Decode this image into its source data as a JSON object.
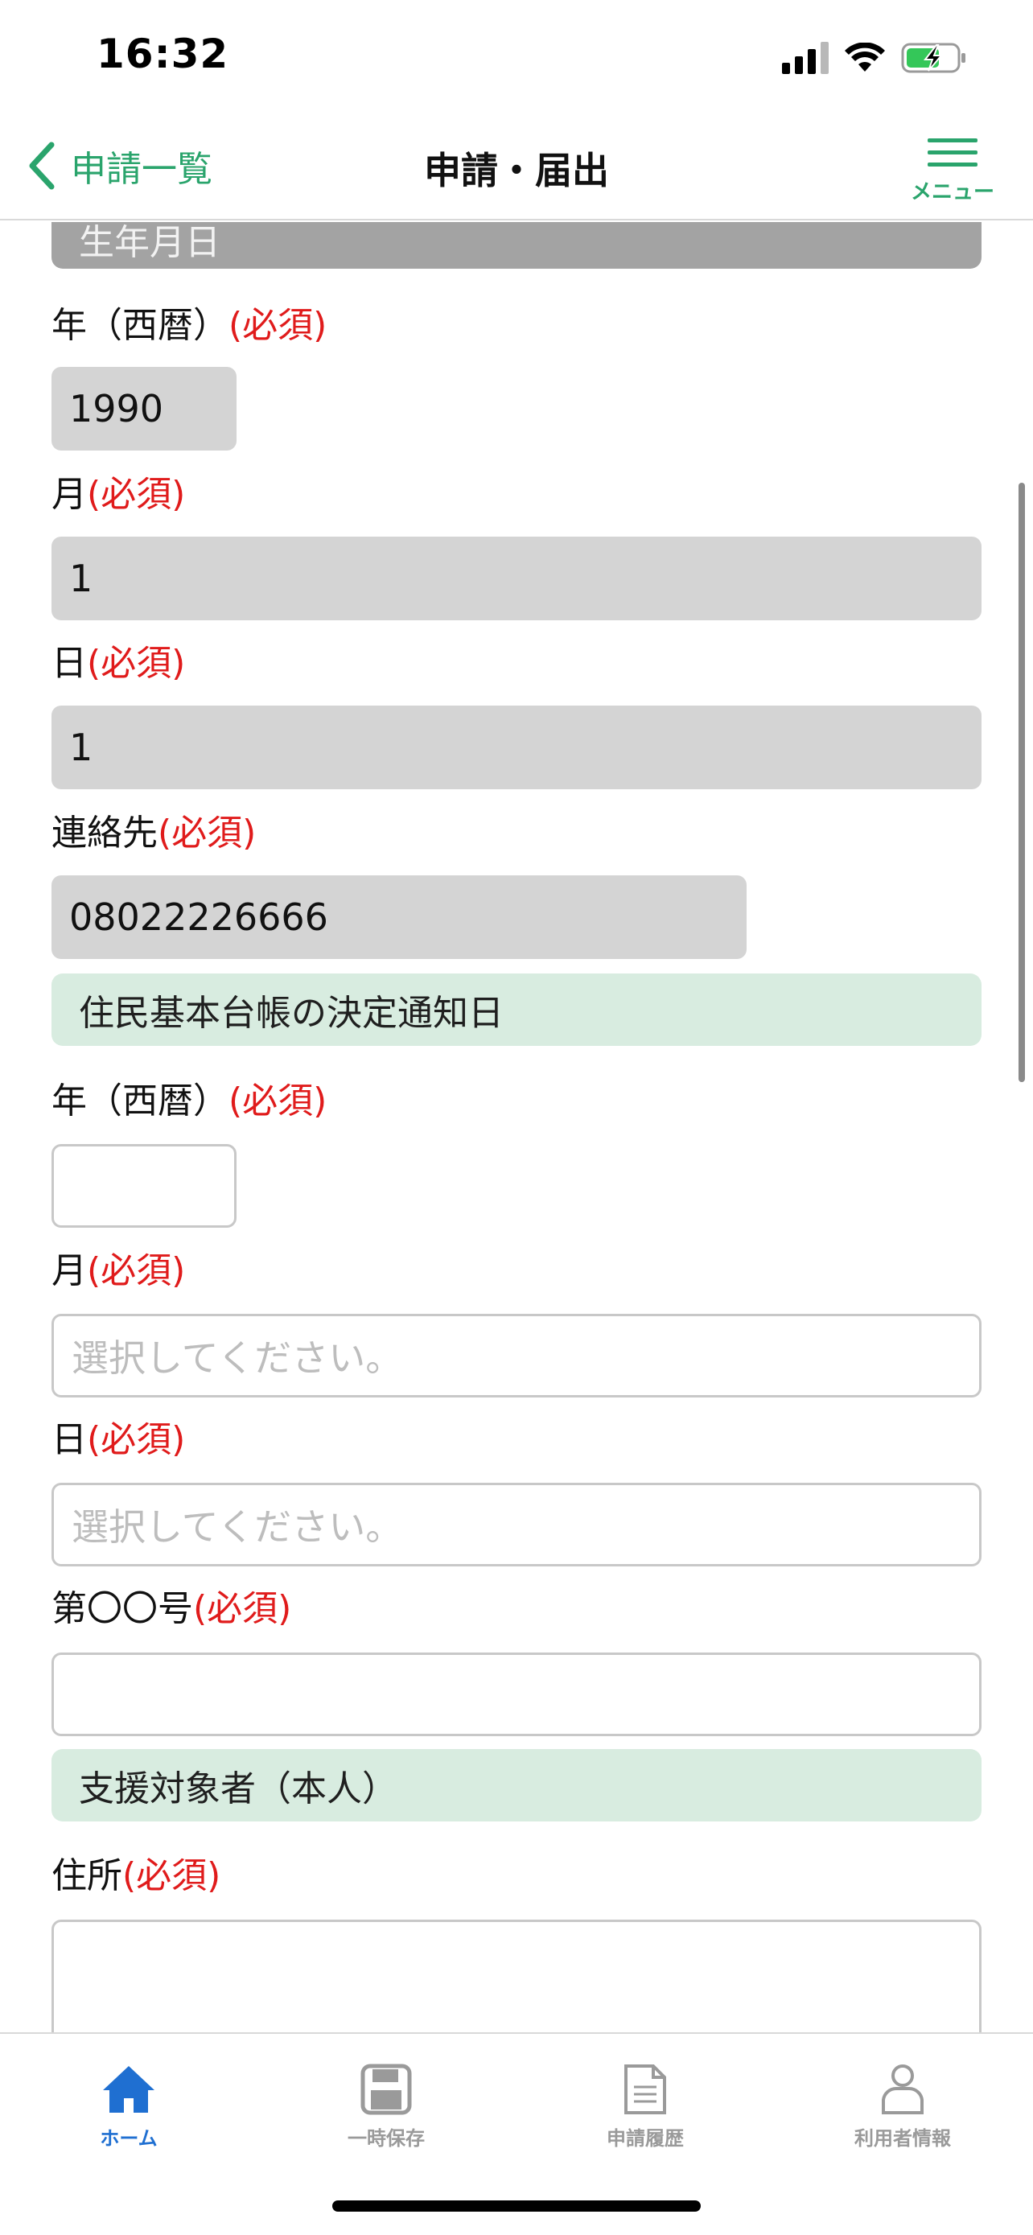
{
  "status_bar": {
    "time": "16:32"
  },
  "nav": {
    "back_label": "申請一覧",
    "title": "申請・届出",
    "menu_label": "メニュー"
  },
  "form": {
    "birth_section": "生年月日",
    "birth_year_label": "年（西暦）",
    "birth_year_value": "1990",
    "birth_month_label": "月",
    "birth_month_value": "1",
    "birth_day_label": "日",
    "birth_day_value": "1",
    "contact_label": "連絡先",
    "contact_value": "08022226666",
    "notice_section": "住民基本台帳の決定通知日",
    "notice_year_label": "年（西暦）",
    "notice_year_value": "",
    "notice_month_label": "月",
    "notice_month_placeholder": "選択してください。",
    "notice_day_label": "日",
    "notice_day_placeholder": "選択してください。",
    "number_label": "第〇〇号",
    "number_value": "",
    "support_section": "支援対象者（本人）",
    "address_label": "住所",
    "address_value": "",
    "required_mark": "(必須)"
  },
  "tabs": [
    {
      "label": "ホーム",
      "icon": "home-icon",
      "active": true
    },
    {
      "label": "一時保存",
      "icon": "save-icon",
      "active": false
    },
    {
      "label": "申請履歴",
      "icon": "document-icon",
      "active": false
    },
    {
      "label": "利用者情報",
      "icon": "user-icon",
      "active": false
    }
  ],
  "colors": {
    "accent_green": "#2aa46c",
    "required_red": "#e01b1b",
    "tab_active_blue": "#1f6fd1",
    "section_green_bg": "#d8ece0",
    "filled_input_bg": "#d4d4d4"
  }
}
